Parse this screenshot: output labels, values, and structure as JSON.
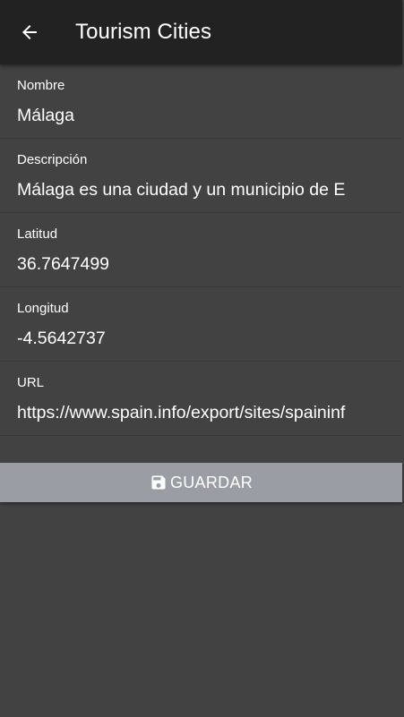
{
  "header": {
    "title": "Tourism Cities",
    "back_icon": "arrow-back-icon"
  },
  "form": {
    "fields": [
      {
        "label": "Nombre",
        "value": "Málaga"
      },
      {
        "label": "Descripción",
        "value": "Málaga es una ciudad y un municipio de E"
      },
      {
        "label": "Latitud",
        "value": "36.7647499"
      },
      {
        "label": "Longitud",
        "value": "-4.5642737"
      },
      {
        "label": "URL",
        "value": "https://www.spain.info/export/sites/spaininf"
      }
    ]
  },
  "save_button": {
    "label": "GUARDAR",
    "icon": "save-icon"
  },
  "colors": {
    "toolbar": "#222222",
    "background": "#424242",
    "button": "#9a9ea4",
    "text": "#ffffff"
  }
}
